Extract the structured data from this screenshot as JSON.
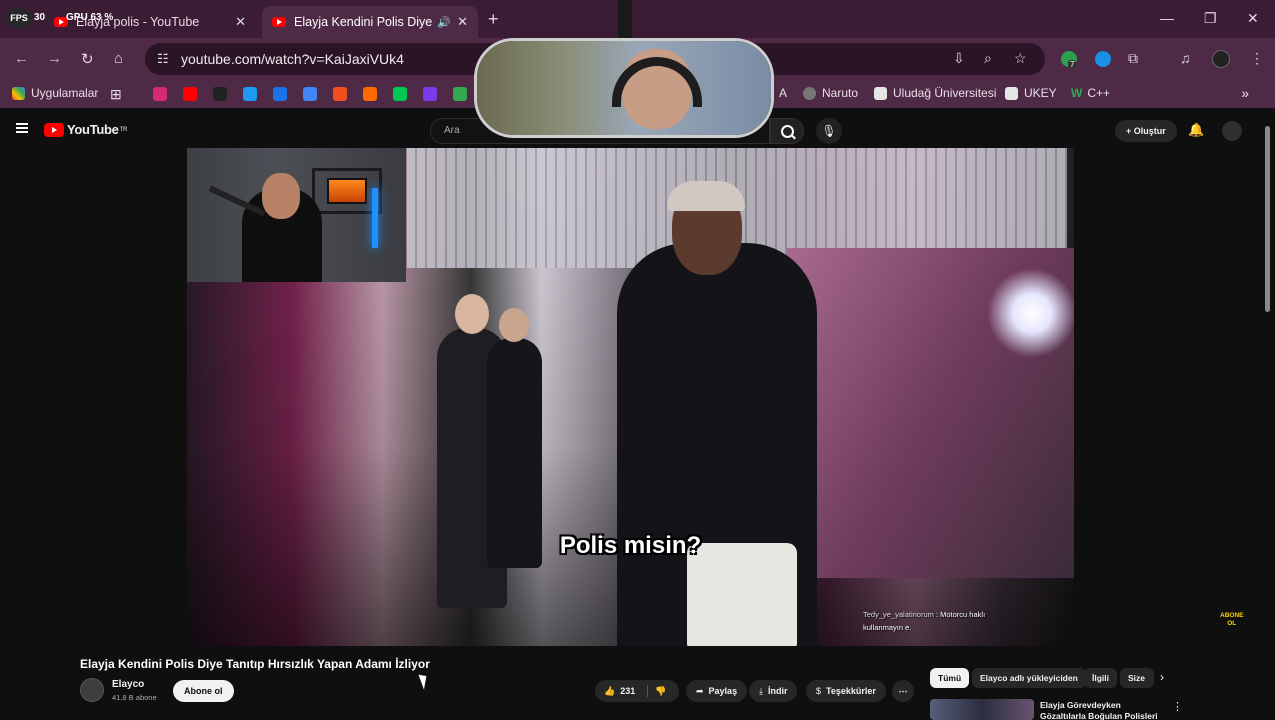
{
  "overlay": {
    "fps_label": "FPS",
    "fps_value": "30",
    "gpu": "GPU 63 %"
  },
  "tabs": [
    {
      "title": "Elayja polis - YouTube",
      "active": false
    },
    {
      "title": "Elayja Kendini Polis Diye Tanıtıp",
      "active": true
    }
  ],
  "omnibox": {
    "url": "youtube.com/watch?v=KaiJaxiVUk4"
  },
  "bookmarks": {
    "apps_label": "Uygulamalar",
    "items": [
      {
        "label": "A",
        "icon": "letter-a"
      },
      {
        "label": "Naruto",
        "icon": "naruto-icon"
      },
      {
        "label": "Uludağ Üniversitesi",
        "icon": "page-icon"
      },
      {
        "label": "UKEY",
        "icon": "page-icon"
      },
      {
        "label": "C++",
        "icon": "w-icon"
      }
    ],
    "favicon_colors": [
      "#d62976",
      "#ff0000",
      "#222222",
      "#1d9bf0",
      "#1a73e8",
      "#4285f4",
      "#f24e1e",
      "#ff6a00",
      "#00c853",
      "#7c3aed",
      "#34a853"
    ]
  },
  "youtube": {
    "logo_text": "YouTube",
    "logo_region": "TR",
    "search_placeholder": "Ara",
    "create_label": "Oluştur"
  },
  "video": {
    "subtitle": "Polis misin?",
    "chat_user": "Tedy_ye_yalatiriorum",
    "chat_message": ": Motorcu haklı kullanmayın e.",
    "abone_badge_line1": "ABONE",
    "abone_badge_line2": "OL",
    "title": "Elayja Kendini Polis Diye Tanıtıp Hırsızlık Yapan Adamı İzliyor"
  },
  "channel": {
    "name": "Elayco",
    "subscribers": "41,8 B abone",
    "subscribe_label": "Abone ol"
  },
  "actions": {
    "likes": "231",
    "share": "Paylaş",
    "download": "İndir",
    "thanks": "Teşekkürler"
  },
  "chips": [
    "Tümü",
    "Elayco adlı yükleyiciden",
    "İlgili",
    "Size"
  ],
  "recommendation": {
    "title": "Elayja Görevdeyken Gözaltılarla Boğulan Polisleri"
  },
  "extension_badge": "7"
}
